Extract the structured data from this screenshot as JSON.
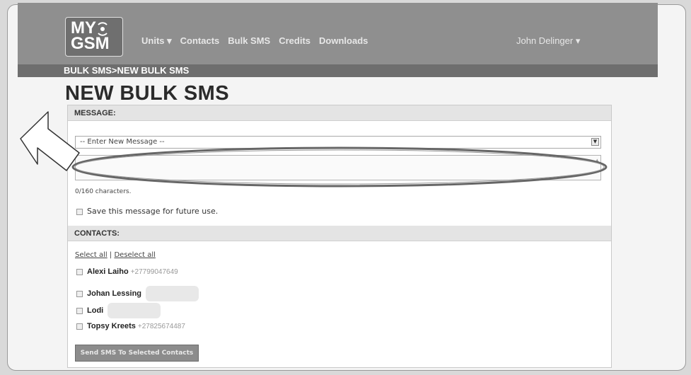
{
  "header": {
    "logo_line1": "MY",
    "logo_line2": "GSM",
    "nav": [
      "Units ▾",
      "Contacts",
      "Bulk SMS",
      "Credits",
      "Downloads"
    ],
    "user": "John Delinger ▾"
  },
  "breadcrumb": "BULK SMS>NEW BULK SMS",
  "page_title": "NEW BULK SMS",
  "message_section": {
    "title": "MESSAGE:",
    "select_value": "-- Enter New Message --",
    "char_count": "0/160 characters.",
    "save_label": "Save this message for future use."
  },
  "contacts_section": {
    "title": "CONTACTS:",
    "select_all": "Select all",
    "separator": "|",
    "deselect_all": "Deselect all",
    "contacts": [
      {
        "name": "Alexi Laiho",
        "phone": "+27799047649"
      },
      {
        "name": "Johan Lessing",
        "phone": ""
      },
      {
        "name": "Lodi",
        "phone": ""
      },
      {
        "name": "Topsy Kreets",
        "phone": "+27825674487"
      }
    ],
    "send_label": "Send SMS To Selected Contacts"
  }
}
